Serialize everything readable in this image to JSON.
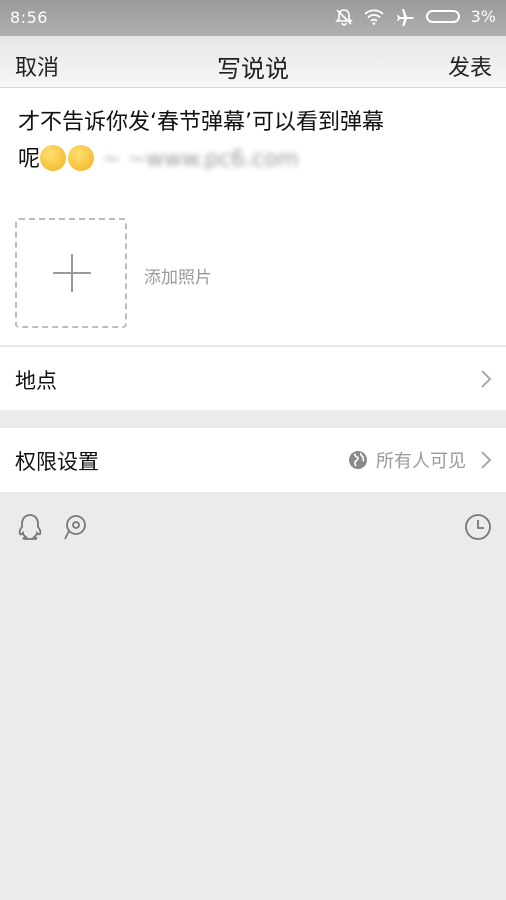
{
  "status_bar": {
    "time": "8:56",
    "battery_percent": "3%",
    "icons": [
      "notification-muted-icon",
      "wifi-icon",
      "airplane-icon",
      "battery-icon"
    ]
  },
  "nav": {
    "cancel": "取消",
    "title": "写说说",
    "publish": "发表"
  },
  "compose": {
    "text_line1": "才不告诉你发‘春节弹幕’可以看到弹幕",
    "text_line2_prefix": "呢",
    "blurred_text": "~ ~www.pc6.com",
    "add_photo_label": "添加照片"
  },
  "rows": {
    "location_label": "地点",
    "permission_label": "权限设置",
    "permission_value": "所有人可见"
  },
  "toolbar": {
    "icons": [
      "qq-icon",
      "mention-icon",
      "clock-icon"
    ]
  },
  "colors": {
    "background": "#ebebeb",
    "card": "#ffffff",
    "secondary_text": "#9a9a9a"
  }
}
